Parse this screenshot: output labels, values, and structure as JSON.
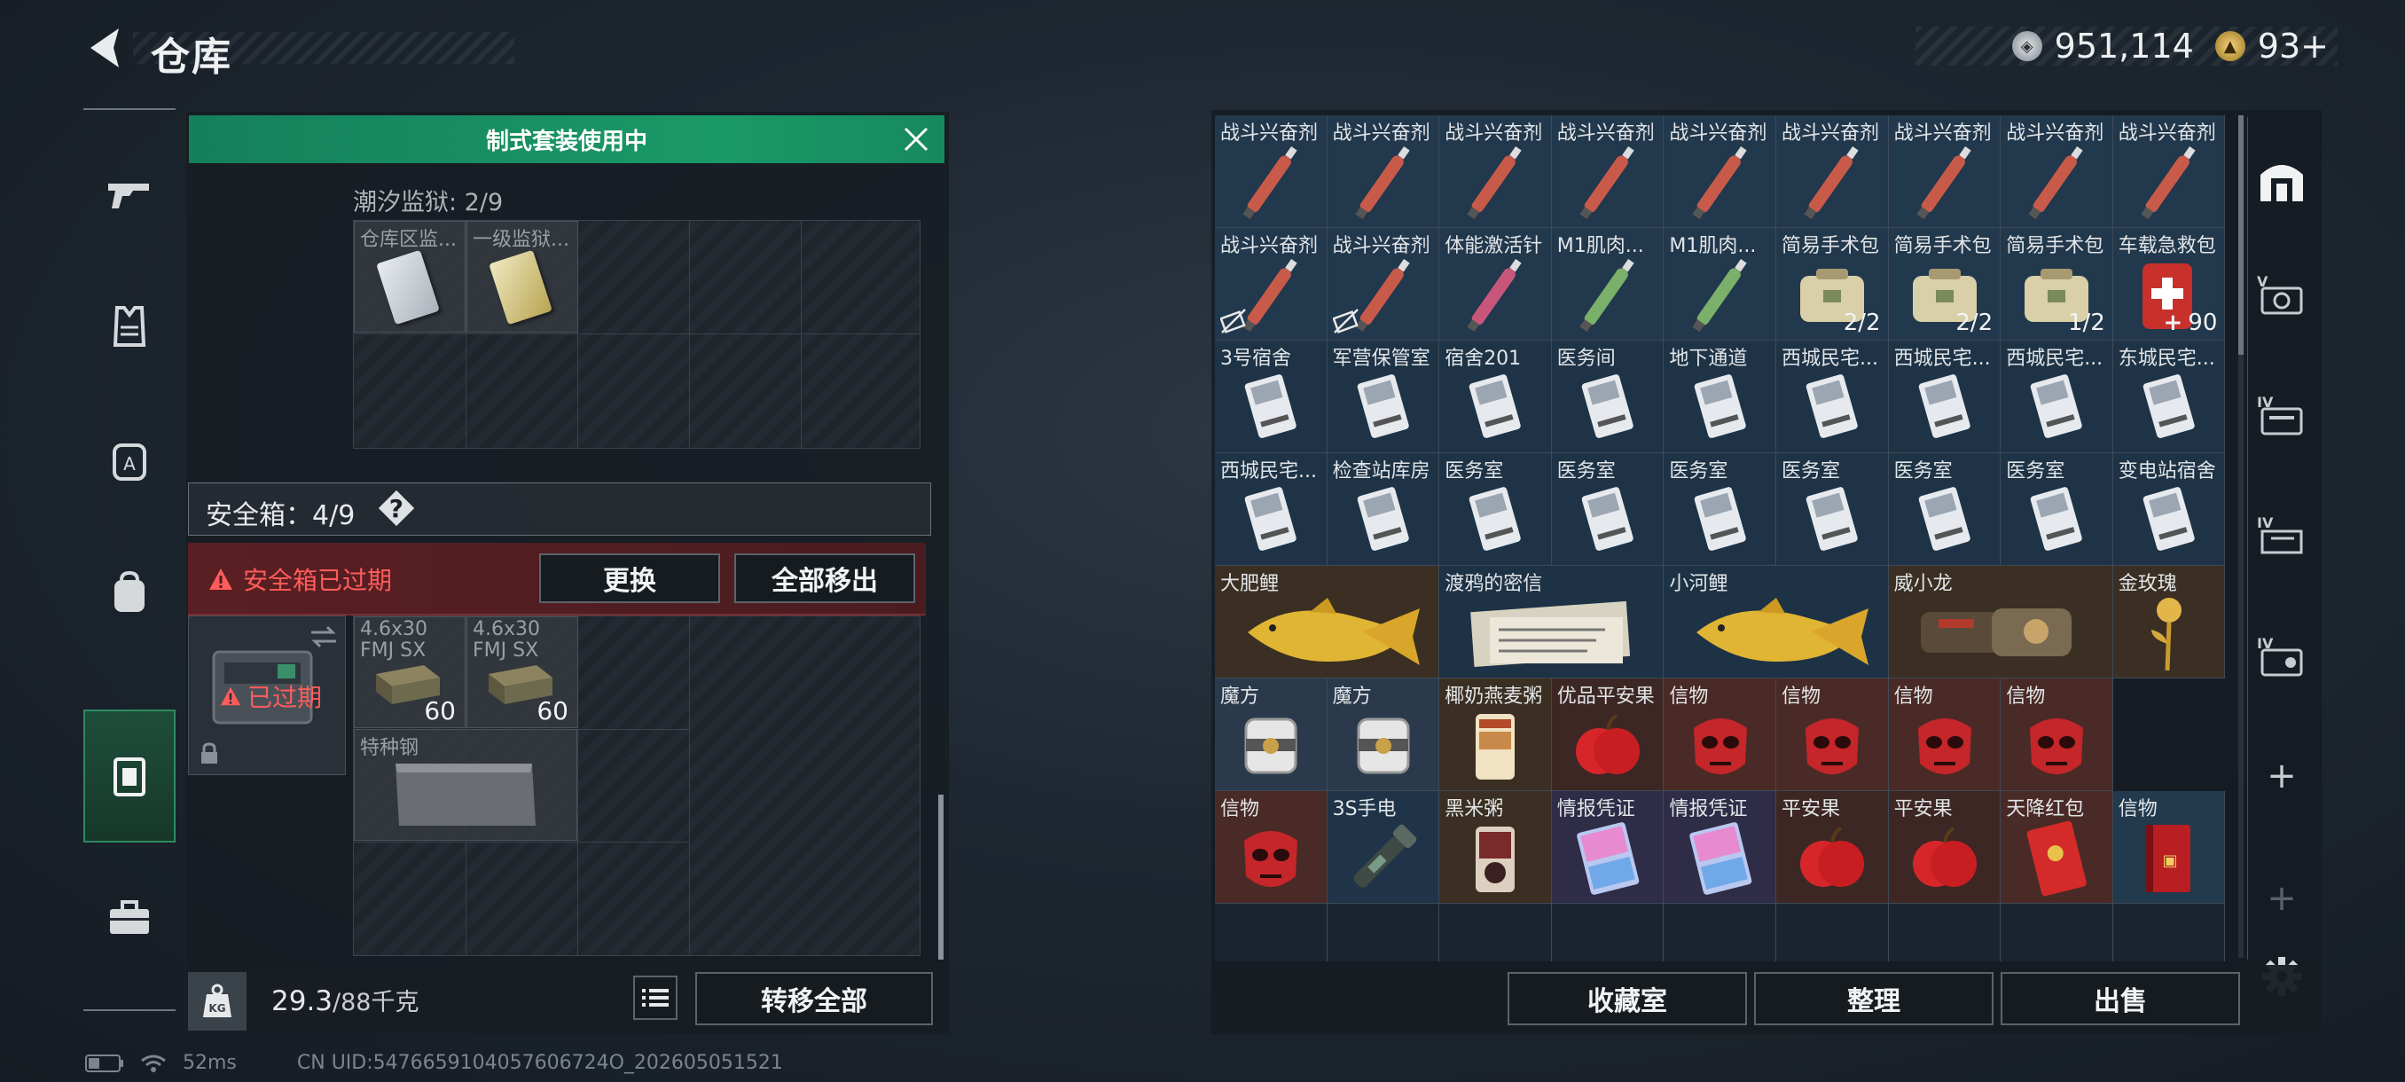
{
  "header": {
    "title": "仓库",
    "currency": [
      {
        "icon": "silver-coin-icon",
        "value": "951,114",
        "color": "#b9c0c8"
      },
      {
        "icon": "gold-coin-icon",
        "value": "93+",
        "color": "#d9b04a"
      }
    ]
  },
  "left_nav": [
    {
      "name": "weapons",
      "icon": "gun-icon"
    },
    {
      "name": "armor",
      "icon": "vest-icon"
    },
    {
      "name": "helmet",
      "icon": "backpack-a-icon"
    },
    {
      "name": "backpack",
      "icon": "backpack-icon"
    },
    {
      "name": "safebox",
      "icon": "chest-rig-icon",
      "active": true
    },
    {
      "name": "toolbox",
      "icon": "toolbox-icon"
    }
  ],
  "kit": {
    "banner": "制式套装使用中",
    "tide_label": "潮汐监狱: 2/9",
    "slots": [
      {
        "label": "仓库区监..."
      },
      {
        "label": "一级监狱..."
      }
    ]
  },
  "safebox": {
    "label": "安全箱：4/9",
    "help": "?",
    "expired_warning": "安全箱已过期",
    "replace_btn": "更换",
    "remove_all_btn": "全部移出",
    "status": "已过期",
    "items": [
      {
        "label": "4.6x30 FMJ SX",
        "count": "60"
      },
      {
        "label": "4.6x30 FMJ SX",
        "count": "60"
      },
      {
        "label": "特种钢"
      }
    ]
  },
  "footer_left": {
    "weight": "29.3",
    "weight_max": "/88千克",
    "transfer_all": "转移全部"
  },
  "inventory": {
    "rows": [
      [
        {
          "name": "战斗兴奋剂",
          "icon": "syringe-red"
        },
        {
          "name": "战斗兴奋剂",
          "icon": "syringe-red"
        },
        {
          "name": "战斗兴奋剂",
          "icon": "syringe-red"
        },
        {
          "name": "战斗兴奋剂",
          "icon": "syringe-red"
        },
        {
          "name": "战斗兴奋剂",
          "icon": "syringe-red"
        },
        {
          "name": "战斗兴奋剂",
          "icon": "syringe-red"
        },
        {
          "name": "战斗兴奋剂",
          "icon": "syringe-red"
        },
        {
          "name": "战斗兴奋剂",
          "icon": "syringe-red"
        },
        {
          "name": "战斗兴奋剂",
          "icon": "syringe-red"
        }
      ],
      [
        {
          "name": "战斗兴奋剂",
          "icon": "syringe-red",
          "flag": "no-transfer"
        },
        {
          "name": "战斗兴奋剂",
          "icon": "syringe-red",
          "flag": "no-transfer"
        },
        {
          "name": "体能激活针",
          "icon": "syringe-pink"
        },
        {
          "name": "M1肌肉...",
          "icon": "syringe-green"
        },
        {
          "name": "M1肌肉...",
          "icon": "syringe-green"
        },
        {
          "name": "简易手术包",
          "icon": "surgery-kit",
          "count": "2/2"
        },
        {
          "name": "简易手术包",
          "icon": "surgery-kit",
          "count": "2/2"
        },
        {
          "name": "简易手术包",
          "icon": "surgery-kit",
          "count": "1/2"
        },
        {
          "name": "车载急救包",
          "icon": "medkit",
          "count": "90",
          "count_prefix": "+"
        }
      ],
      [
        {
          "name": "3号宿舍",
          "icon": "keycard"
        },
        {
          "name": "军营保管室",
          "icon": "keycard"
        },
        {
          "name": "宿舍201",
          "icon": "keycard"
        },
        {
          "name": "医务间",
          "icon": "keycard"
        },
        {
          "name": "地下通道",
          "icon": "keycard"
        },
        {
          "name": "西城民宅...",
          "icon": "keycard"
        },
        {
          "name": "西城民宅...",
          "icon": "keycard"
        },
        {
          "name": "西城民宅...",
          "icon": "keycard"
        },
        {
          "name": "东城民宅...",
          "icon": "keycard"
        }
      ],
      [
        {
          "name": "西城民宅...",
          "icon": "keycard"
        },
        {
          "name": "检查站库房",
          "icon": "keycard"
        },
        {
          "name": "医务室",
          "icon": "keycard"
        },
        {
          "name": "医务室",
          "icon": "keycard"
        },
        {
          "name": "医务室",
          "icon": "keycard"
        },
        {
          "name": "医务室",
          "icon": "keycard"
        },
        {
          "name": "医务室",
          "icon": "keycard"
        },
        {
          "name": "医务室",
          "icon": "keycard"
        },
        {
          "name": "变电站宿舍",
          "icon": "keycard"
        }
      ]
    ],
    "row5": [
      {
        "name": "大肥鲤",
        "icon": "fish",
        "span": 2
      },
      {
        "name": "渡鸦的密信",
        "icon": "letter",
        "span": 2
      },
      {
        "name": "小河鲤",
        "icon": "fish",
        "span": 2
      },
      {
        "name": "威小龙",
        "icon": "gauntlet",
        "span": 2
      },
      {
        "name": "金玫瑰",
        "icon": "golden-rose",
        "span": 1
      }
    ],
    "row6": [
      {
        "name": "魔方",
        "icon": "cube"
      },
      {
        "name": "魔方",
        "icon": "cube"
      },
      {
        "name": "椰奶燕麦粥",
        "icon": "porridge"
      },
      {
        "name": "优品平安果",
        "icon": "apple"
      },
      {
        "name": "信物",
        "icon": "red-mask"
      },
      {
        "name": "信物",
        "icon": "red-mask"
      },
      {
        "name": "信物",
        "icon": "red-mask"
      },
      {
        "name": "信物",
        "icon": "red-mask"
      }
    ],
    "row7": [
      {
        "name": "信物",
        "icon": "red-mask"
      },
      {
        "name": "3S手电",
        "icon": "flashlight"
      },
      {
        "name": "黑米粥",
        "icon": "porridge-dark"
      },
      {
        "name": "情报凭证",
        "icon": "intel-card"
      },
      {
        "name": "情报凭证",
        "icon": "intel-card"
      },
      {
        "name": "平安果",
        "icon": "apple"
      },
      {
        "name": "平安果",
        "icon": "apple"
      },
      {
        "name": "天降红包",
        "icon": "red-envelope"
      },
      {
        "name": "信物",
        "icon": "red-book"
      }
    ]
  },
  "footer_right": {
    "collection_btn": "收藏室",
    "sort_btn": "整理",
    "sell_btn": "出售"
  },
  "right_nav": [
    {
      "icon": "home-icon"
    },
    {
      "icon": "storage-v-icon"
    },
    {
      "icon": "storage-iv-a-icon"
    },
    {
      "icon": "storage-iv-b-icon"
    },
    {
      "icon": "storage-iv-c-icon"
    },
    {
      "icon": "plus-icon",
      "label": "+"
    },
    {
      "icon": "plus-dim-icon",
      "label": "+"
    },
    {
      "icon": "gear-icon"
    }
  ],
  "status": {
    "ping": "52ms",
    "uid": "CN UID:5476659104057606724O_202605051521"
  }
}
